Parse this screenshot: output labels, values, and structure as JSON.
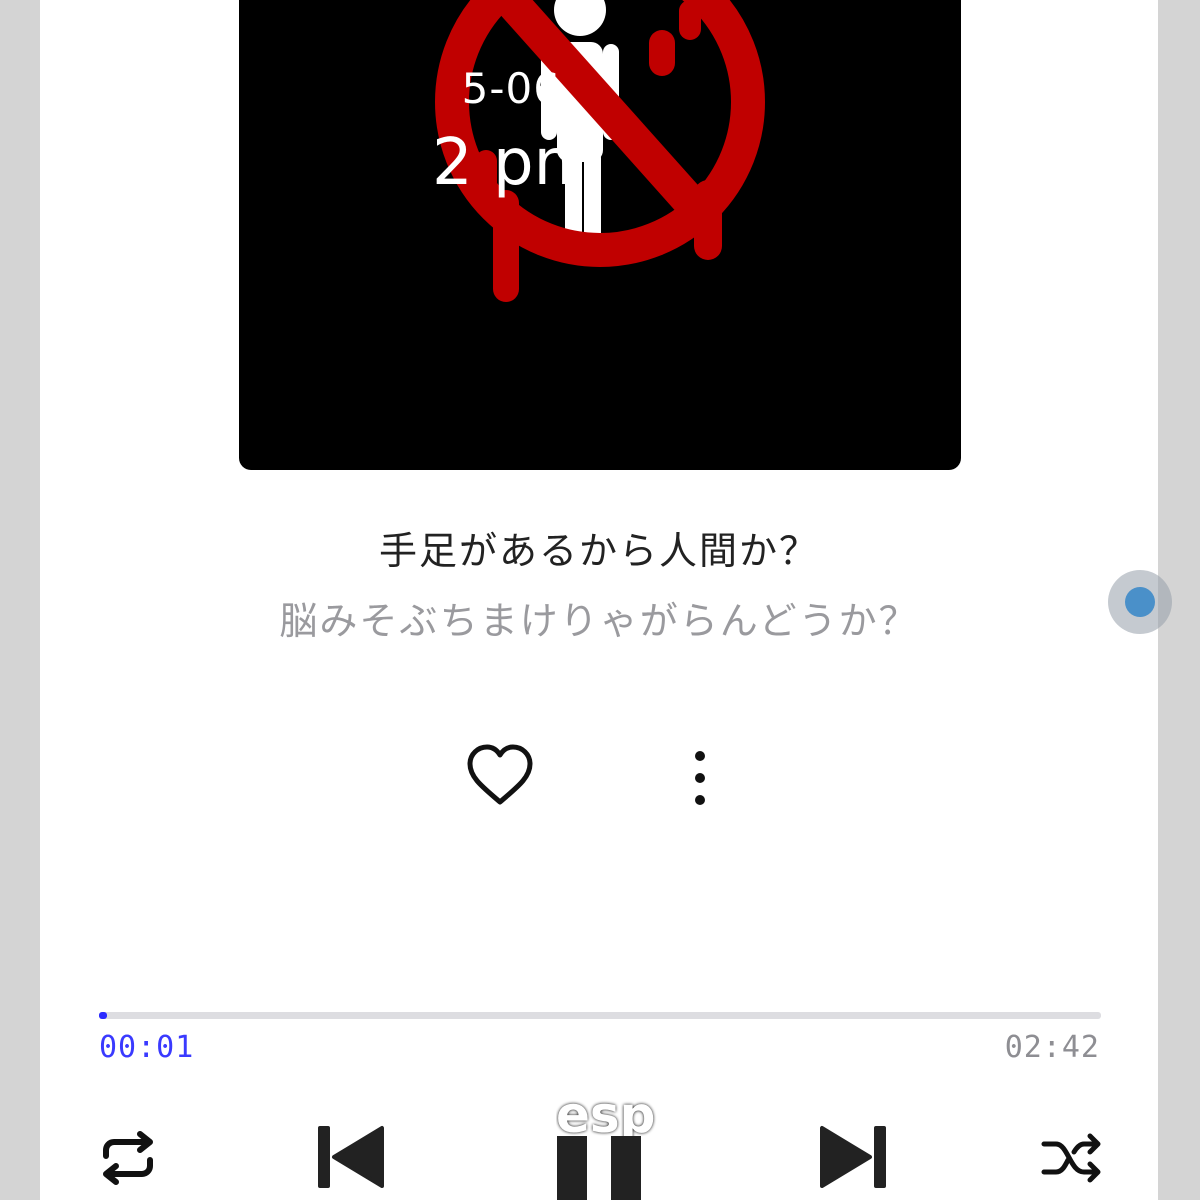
{
  "overlay": {
    "date_fragment": "5-06",
    "time_fragment": "2 pm",
    "bottom_word_fragment": "esp"
  },
  "now_playing": {
    "title": "手足があるから人間か？",
    "artist": "脳みそぶちまけりゃがらんどうか？",
    "artwork_icon": "no-humans-prohibition-sign"
  },
  "playback": {
    "elapsed": "00:01",
    "total": "02:42",
    "progress_fraction": 0.006
  },
  "controls": {
    "repeat_icon": "repeat-icon",
    "previous_icon": "skip-previous-icon",
    "pause_icon": "pause-icon",
    "next_icon": "skip-next-icon",
    "shuffle_icon": "shuffle-icon",
    "like_icon": "heart-outline-icon",
    "more_icon": "more-vertical-icon"
  },
  "colors": {
    "accent": "#2b2bff",
    "prohibition_red": "#c00000"
  }
}
